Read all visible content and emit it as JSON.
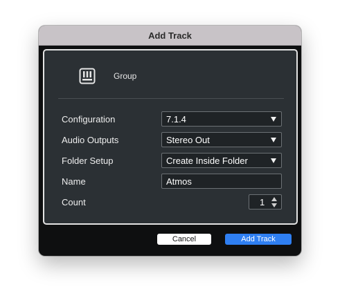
{
  "dialog": {
    "title": "Add Track"
  },
  "header": {
    "icon": "group-track-icon",
    "label": "Group"
  },
  "fields": [
    {
      "label": "Configuration",
      "type": "dropdown",
      "value": "7.1.4"
    },
    {
      "label": "Audio Outputs",
      "type": "dropdown",
      "value": "Stereo Out"
    },
    {
      "label": "Folder Setup",
      "type": "dropdown",
      "value": "Create Inside Folder"
    },
    {
      "label": "Name",
      "type": "text",
      "value": "Atmos"
    },
    {
      "label": "Count",
      "type": "stepper",
      "value": "1"
    }
  ],
  "buttons": {
    "cancel": "Cancel",
    "add": "Add Track"
  },
  "colors": {
    "titlebar": "#c8c3c7",
    "panel": "#2b3034",
    "primary_button": "#2f7ff2"
  }
}
